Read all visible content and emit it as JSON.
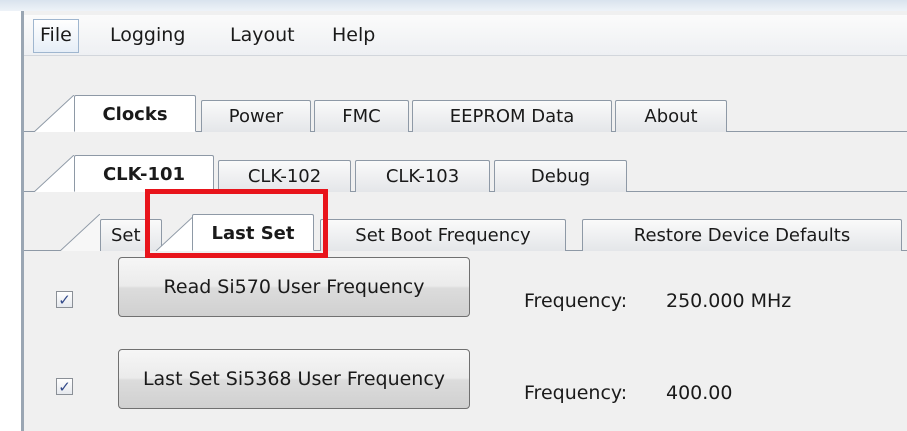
{
  "menu": {
    "file": "File",
    "logging": "Logging",
    "layout": "Layout",
    "help": "Help"
  },
  "main_tabs": {
    "clocks": "Clocks",
    "power": "Power",
    "fmc": "FMC",
    "eeprom": "EEPROM Data",
    "about": "About",
    "selected": "Clocks"
  },
  "clk_tabs": {
    "clk101": "CLK-101",
    "clk102": "CLK-102",
    "clk103": "CLK-103",
    "debug": "Debug",
    "selected": "CLK-101"
  },
  "sub_tabs": {
    "set": "Set",
    "last_set": "Last Set",
    "set_boot": "Set Boot Frequency",
    "restore": "Restore Device Defaults",
    "selected": "Last Set"
  },
  "rows": [
    {
      "checked": true,
      "button_label": "Read Si570 User Frequency",
      "freq_label": "Frequency:",
      "freq_value": "250.000 MHz"
    },
    {
      "checked": true,
      "button_label": "Last Set Si5368 User Frequency",
      "freq_label": "Frequency:",
      "freq_value": "400.00"
    }
  ],
  "colors": {
    "highlight": "#e8141b",
    "check": "#334a8a"
  },
  "icons": {
    "checkbox_mark": "✓"
  }
}
